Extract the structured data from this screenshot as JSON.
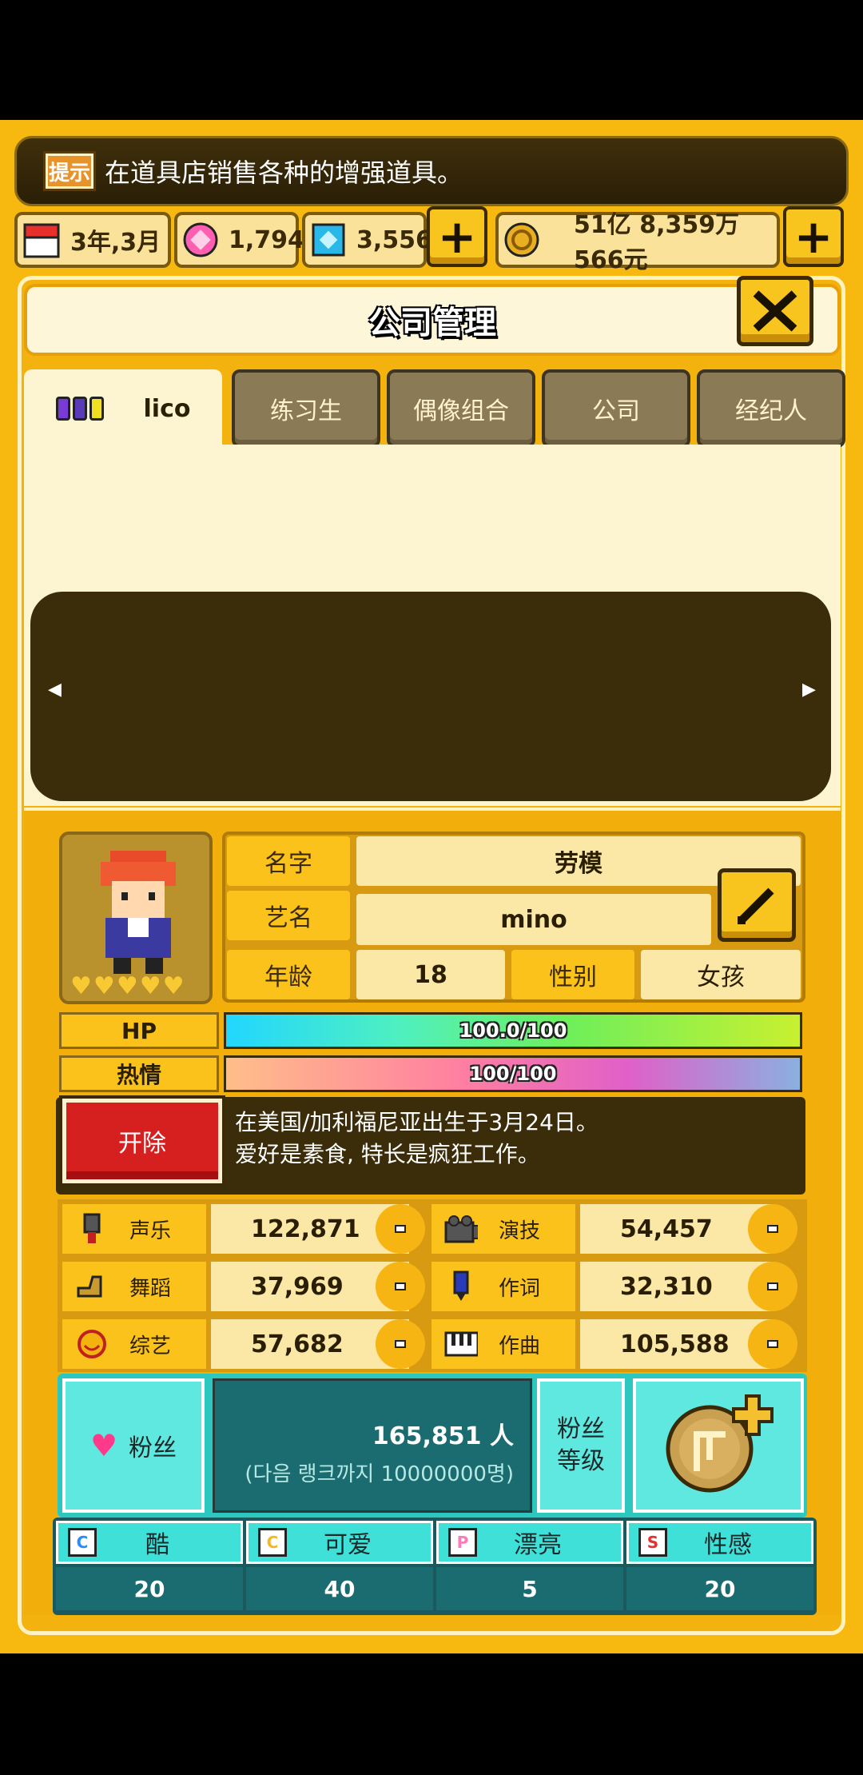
{
  "tip": {
    "icon_label": "提示",
    "text": "在道具店销售各种的增强道具。"
  },
  "status": {
    "date": "3年,3月",
    "pink_gems": "1,794",
    "blue_gems": "3,556",
    "money": "51亿 8,359万 566元",
    "plus_label": "+"
  },
  "panel": {
    "title": "公司管理"
  },
  "tabs": [
    {
      "label": "lico"
    },
    {
      "label": "练习生"
    },
    {
      "label": "偶像组合"
    },
    {
      "label": "公司"
    },
    {
      "label": "经纪人"
    }
  ],
  "profile": {
    "name_label": "名字",
    "name": "劳模",
    "stage_label": "艺名",
    "stage_name": "mino",
    "age_label": "年龄",
    "age": "18",
    "gender_label": "性别",
    "gender": "女孩"
  },
  "bars": {
    "hp_label": "HP",
    "hp_text": "100.0/100",
    "hp_fraction": 1.0,
    "passion_label": "热情",
    "passion_text": "100/100",
    "passion_fraction": 1.0
  },
  "fire_label": "开除",
  "bio": {
    "line1": "在美国/加利福尼亚出生于3月24日。",
    "line2": "爱好是素食, 特长是疯狂工作。"
  },
  "skills": [
    {
      "label": "声乐",
      "value": "122,871",
      "icon": "microphone-icon"
    },
    {
      "label": "演技",
      "value": "54,457",
      "icon": "camera-icon"
    },
    {
      "label": "舞蹈",
      "value": "37,969",
      "icon": "shoe-icon"
    },
    {
      "label": "作词",
      "value": "32,310",
      "icon": "pen-icon"
    },
    {
      "label": "综艺",
      "value": "57,682",
      "icon": "smile-icon"
    },
    {
      "label": "作曲",
      "value": "105,588",
      "icon": "piano-icon"
    }
  ],
  "fans": {
    "label": "粉丝",
    "count": "165,851 人",
    "next": "(다음 랭크까지 10000000명)",
    "rank_label_1": "粉丝",
    "rank_label_2": "等级"
  },
  "style_stats": [
    {
      "label": "酷",
      "value": "20",
      "letter": "C",
      "color": "#2a8cff"
    },
    {
      "label": "可爱",
      "value": "40",
      "letter": "C",
      "color": "#f5b820"
    },
    {
      "label": "漂亮",
      "value": "5",
      "letter": "P",
      "color": "#ff7ab8"
    },
    {
      "label": "性感",
      "value": "20",
      "letter": "S",
      "color": "#e83030"
    }
  ]
}
